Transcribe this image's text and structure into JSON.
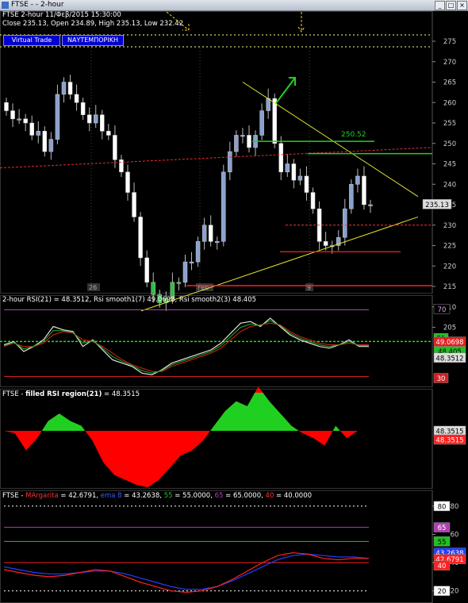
{
  "window": {
    "title": "FTSE -  - 2-hour",
    "min_icon": "minimize-icon",
    "max_icon": "maximize-icon",
    "close_icon": "close-icon"
  },
  "price_panel": {
    "header_line1": "FTSE  2-hour   11/Φεβ/2015 15:30:00",
    "header_line2": "Close 235.13, Open 234.89, High 235.13, Low 232.42",
    "button_virtual": "Virtual Trade",
    "button_greek": "ΝΑΥΤΕΜΠΟΡΙΚΗ",
    "level_label": "250.52",
    "last_price": "235.13",
    "yticks": [
      "275",
      "270",
      "265",
      "260",
      "255",
      "250",
      "245",
      "240",
      "235",
      "230",
      "225",
      "220",
      "215",
      "210",
      "205"
    ],
    "xlabels": [
      "26",
      "Feb",
      "9"
    ]
  },
  "rsi_panel": {
    "header": "2-hour RSI(21) = 48.3512, Rsi smooth1(7) 49.0698, Rsi smooth2(3) 48.405",
    "badges": {
      "b70": "70",
      "b51": "51",
      "b49": "49.0698",
      "b48a": "48.405",
      "b48b": "48.3512",
      "b30": "30"
    }
  },
  "filled_panel": {
    "header_prefix": "FTSE - ",
    "header_name": "filled RSI region(21)",
    "header_value": " = 48.3515",
    "badges": {
      "v1": "48.3515",
      "v2": "48.3515"
    }
  },
  "margarita_panel": {
    "header_prefix": "FTSE - ",
    "h1": "MArgarita",
    "h1v": " = 42.6791, ",
    "h2": "ema 8",
    "h2v": " = 43.2638, ",
    "h3": "55",
    "h3v": " = 55.0000, ",
    "h4": "65",
    "h4v": " = 65.0000, ",
    "h5": "40",
    "h5v": " = 40.0000",
    "badges": {
      "b80": "80",
      "b65": "65",
      "b60": "60",
      "b55": "55",
      "b43": "43.2638",
      "b42": "42.6791",
      "b40": "40",
      "b20": "20"
    },
    "yticks": [
      "80",
      "60",
      "40",
      "20"
    ]
  },
  "chart_data": [
    {
      "type": "candlestick",
      "title": "FTSE 2-hour",
      "ylim": [
        205,
        276
      ],
      "approx_closes": [
        258,
        256,
        256,
        255,
        252,
        253,
        248,
        251,
        262,
        265,
        262,
        260,
        257,
        255,
        257,
        253,
        252,
        246,
        243,
        238,
        232,
        222,
        216,
        213,
        211,
        212,
        216,
        216,
        221,
        221,
        226,
        230,
        226,
        226,
        243,
        248,
        252,
        252,
        249,
        252,
        258,
        261,
        250,
        243,
        245,
        241,
        242,
        238,
        234,
        226,
        225,
        225,
        227,
        234,
        240,
        242,
        235,
        235
      ],
      "levels": [
        {
          "label": "250.52",
          "value": 250.52
        }
      ],
      "last": 235.13,
      "x_labels": [
        "26",
        "Feb",
        "9"
      ]
    },
    {
      "type": "line",
      "title": "2-hour RSI(21)",
      "ylim": [
        25,
        75
      ],
      "reference": [
        70,
        51,
        30
      ],
      "series": [
        {
          "name": "RSI",
          "last": 48.3512
        },
        {
          "name": "Rsi smooth1",
          "last": 49.0698
        },
        {
          "name": "Rsi smooth2",
          "last": 48.405
        }
      ]
    },
    {
      "type": "area",
      "title": "filled RSI region(21)",
      "baseline": 50,
      "last": 48.3515
    },
    {
      "type": "line",
      "title": "MArgarita",
      "ylim": [
        15,
        85
      ],
      "reference": [
        80,
        65,
        55,
        40,
        20
      ],
      "series": [
        {
          "name": "MArgarita",
          "last": 42.6791
        },
        {
          "name": "ema 8",
          "last": 43.2638
        }
      ]
    }
  ]
}
